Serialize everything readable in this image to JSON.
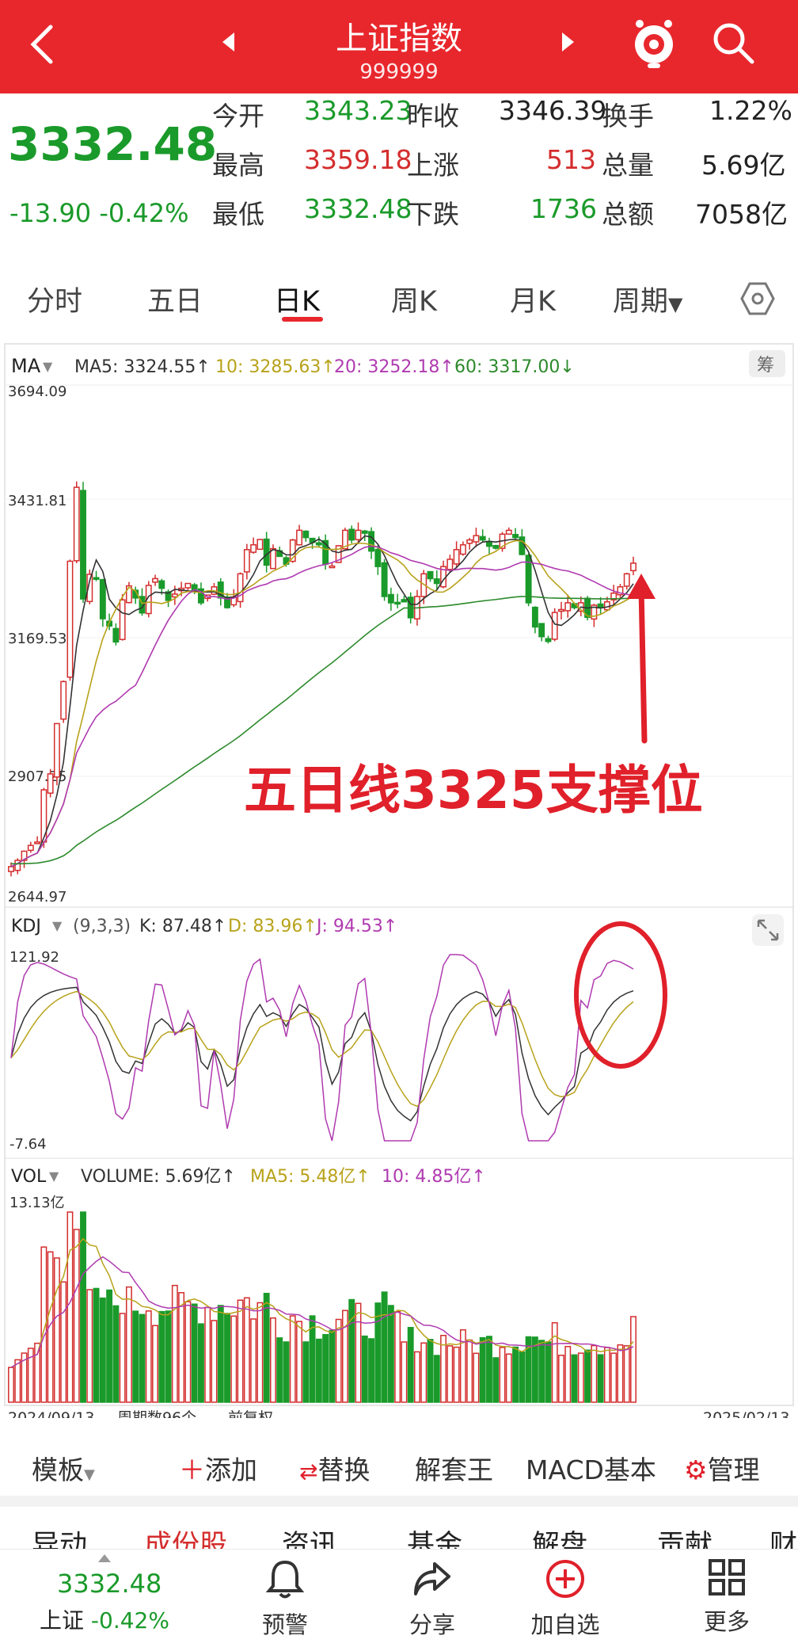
{
  "header": {
    "title": "上证指数",
    "code": "999999",
    "back_icon": "chevron-left-icon",
    "prev_icon": "triangle-left-icon",
    "next_icon": "triangle-right-icon",
    "mascot_icon": "mascot-icon",
    "search_icon": "search-icon",
    "bg_color": "#e8272d"
  },
  "quote": {
    "price": "3332.48",
    "change": "-13.90",
    "change_pct": "-0.42%",
    "rows": [
      {
        "l1": "今开",
        "v1": "3343.23",
        "l2": "昨收",
        "v2": "3346.39",
        "l3": "换手",
        "v3": "1.22%"
      },
      {
        "l1": "最高",
        "v1": "3359.18",
        "l2": "上涨",
        "v2": "513",
        "l3": "总量",
        "v3": "5.69亿"
      },
      {
        "l1": "最低",
        "v1": "3332.48",
        "l2": "下跌",
        "v2": "1736",
        "l3": "总额",
        "v3": "7058亿"
      }
    ]
  },
  "tabs": {
    "items": [
      "分时",
      "五日",
      "日K",
      "周K",
      "月K",
      "周期"
    ],
    "active": "日K",
    "settings_icon": "hexagon-settings-icon"
  },
  "ma_panel": {
    "indicator": "MA",
    "ma5": "MA5: 3324.55↑",
    "ma10": "10: 3285.63↑",
    "ma20": "20: 3252.18↑",
    "ma60": "60: 3317.00↓",
    "chip_label": "筹",
    "y_labels": [
      "3694.09",
      "3431.81",
      "3169.53",
      "2907.25",
      "2644.97"
    ],
    "annotation": "五日线3325支撑位"
  },
  "kdj_panel": {
    "indicator": "KDJ",
    "params": "(9,3,3)",
    "k": "K: 87.48↑",
    "d": "D: 83.96↑",
    "j": "J: 94.53↑",
    "y_top": "121.92",
    "y_bottom": "-7.64",
    "expand_icon": "expand-icon"
  },
  "vol_panel": {
    "indicator": "VOL",
    "volume": "VOLUME: 5.69亿↑",
    "ma5": "MA5: 5.48亿↑",
    "ma10": "10: 4.85亿↑",
    "y_top": "13.13亿",
    "date_start": "2024/09/13",
    "period_count": "周期数96个",
    "adjust": "前复权",
    "date_end": "2025/02/13"
  },
  "toolbar": {
    "template": "模板",
    "add": "添加",
    "replace": "替换",
    "unlock": "解套王",
    "macd": "MACD基本",
    "manage": "管理"
  },
  "bottom_tabs": [
    "异动",
    "成份股",
    "资讯",
    "基金",
    "解盘",
    "贡献",
    "财"
  ],
  "bottom_bar": {
    "price": "3332.48",
    "name": "上证",
    "pct": "-0.42%",
    "alert": "预警",
    "share": "分享",
    "add_fav": "加自选",
    "more": "更多"
  },
  "colors": {
    "up": "#d42d2d",
    "down": "#1a9a2a",
    "ma5": "#333333",
    "ma10": "#b8a21a",
    "ma20": "#b03ab0",
    "ma60": "#2c8a2c"
  },
  "chart_data": {
    "type": "candlestick",
    "x_start": "2024/09/13",
    "x_end": "2025/02/13",
    "periods": 96,
    "close_series": [
      2704,
      2717,
      2736,
      2748,
      2755,
      2863,
      2896,
      3000,
      3087,
      3336,
      3489,
      3258,
      3309,
      3301,
      3217,
      3202,
      3169,
      3256,
      3285,
      3260,
      3229,
      3286,
      3300,
      3280,
      3255,
      3268,
      3280,
      3290,
      3275,
      3250,
      3266,
      3283,
      3260,
      3240,
      3262,
      3310,
      3360,
      3370,
      3381,
      3328,
      3362,
      3346,
      3330,
      3380,
      3400,
      3385,
      3375,
      3370,
      3330,
      3326,
      3368,
      3400,
      3380,
      3400,
      3394,
      3357,
      3325,
      3263,
      3250,
      3250,
      3252,
      3219,
      3263,
      3310,
      3300,
      3290,
      3325,
      3340,
      3360,
      3370,
      3380,
      3389,
      3380,
      3367,
      3363,
      3392,
      3400,
      3385,
      3350,
      3250,
      3200,
      3180,
      3170,
      3230,
      3236,
      3250,
      3240,
      3250,
      3220,
      3245,
      3240,
      3252,
      3270,
      3283,
      3310,
      3332
    ],
    "ma5_last": 3324.55,
    "ma10_last": 3285.63,
    "ma20_last": 3252.18,
    "ma60_last": 3317.0,
    "y_range": [
      2644.97,
      3694.09
    ],
    "kdj_last": {
      "k": 87.48,
      "d": 83.96,
      "j": 94.53
    },
    "kdj_range": [
      -7.64,
      121.92
    ],
    "volume_last": 5.69,
    "volume_max": 13.13
  }
}
